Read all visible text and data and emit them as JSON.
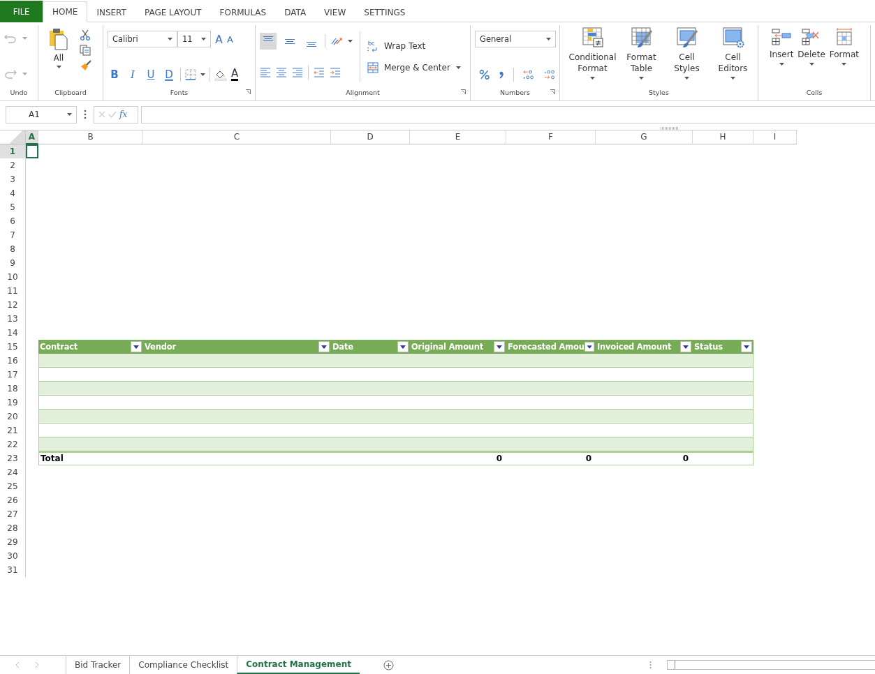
{
  "file_button": "FILE",
  "menu_tabs": [
    {
      "label": "HOME",
      "selected": true
    },
    {
      "label": "INSERT",
      "selected": false
    },
    {
      "label": "PAGE LAYOUT",
      "selected": false
    },
    {
      "label": "FORMULAS",
      "selected": false
    },
    {
      "label": "DATA",
      "selected": false
    },
    {
      "label": "VIEW",
      "selected": false
    },
    {
      "label": "SETTINGS",
      "selected": false
    }
  ],
  "ribbon": {
    "undo": {
      "group_label": "Undo"
    },
    "clipboard": {
      "paste_label": "All",
      "group_label": "Clipboard"
    },
    "fonts": {
      "font_name": "Calibri",
      "font_size": "11",
      "grow_label": "A",
      "shrink_label": "A",
      "font_color_label": "A",
      "group_label": "Fonts",
      "style_buttons": [
        {
          "label": "B",
          "kind": "bold"
        },
        {
          "label": "I",
          "kind": "italic"
        },
        {
          "label": "U",
          "kind": "underline"
        },
        {
          "label": "D",
          "kind": "double-underline"
        }
      ]
    },
    "alignment": {
      "vertical_buttons": [
        {
          "kind": "top",
          "selected": true
        },
        {
          "kind": "middle",
          "selected": false
        },
        {
          "kind": "bottom",
          "selected": false
        }
      ],
      "wrap_text": "Wrap Text",
      "merge": "Merge & Center",
      "group_label": "Alignment"
    },
    "numbers": {
      "format": "General",
      "group_label": "Numbers"
    },
    "styles": {
      "buttons": [
        {
          "label": "Conditional Format",
          "kind": "conditional-format"
        },
        {
          "label": "Format Table",
          "kind": "format-table"
        },
        {
          "label": "Cell Styles",
          "kind": "cell-styles"
        },
        {
          "label": "Cell Editors",
          "kind": "cell-editors"
        }
      ],
      "group_label": "Styles"
    },
    "cells": {
      "buttons": [
        {
          "label": "Insert",
          "kind": "insert"
        },
        {
          "label": "Delete",
          "kind": "delete"
        },
        {
          "label": "Format",
          "kind": "format"
        }
      ],
      "group_label": "Cells"
    }
  },
  "formula_bar": {
    "name_box": "A1",
    "fx": "fx"
  },
  "sheet": {
    "columns": [
      {
        "label": "A",
        "selected": true
      },
      {
        "label": "B",
        "selected": false
      },
      {
        "label": "C",
        "selected": false
      },
      {
        "label": "D",
        "selected": false
      },
      {
        "label": "E",
        "selected": false
      },
      {
        "label": "F",
        "selected": false
      },
      {
        "label": "G",
        "selected": false
      },
      {
        "label": "H",
        "selected": false
      },
      {
        "label": "I",
        "selected": false
      }
    ],
    "rows": [
      {
        "label": "1",
        "selected": true
      },
      {
        "label": "2",
        "selected": false
      },
      {
        "label": "3",
        "selected": false
      },
      {
        "label": "4",
        "selected": false
      },
      {
        "label": "5",
        "selected": false
      },
      {
        "label": "6",
        "selected": false
      },
      {
        "label": "7",
        "selected": false
      },
      {
        "label": "8",
        "selected": false
      },
      {
        "label": "9",
        "selected": false
      },
      {
        "label": "10",
        "selected": false
      },
      {
        "label": "11",
        "selected": false
      },
      {
        "label": "12",
        "selected": false
      },
      {
        "label": "13",
        "selected": false
      },
      {
        "label": "14",
        "selected": false
      },
      {
        "label": "15",
        "selected": false
      },
      {
        "label": "16",
        "selected": false
      },
      {
        "label": "17",
        "selected": false
      },
      {
        "label": "18",
        "selected": false
      },
      {
        "label": "19",
        "selected": false
      },
      {
        "label": "20",
        "selected": false
      },
      {
        "label": "21",
        "selected": false
      },
      {
        "label": "22",
        "selected": false
      },
      {
        "label": "23",
        "selected": false
      },
      {
        "label": "24",
        "selected": false
      },
      {
        "label": "25",
        "selected": false
      },
      {
        "label": "26",
        "selected": false
      },
      {
        "label": "27",
        "selected": false
      },
      {
        "label": "28",
        "selected": false
      },
      {
        "label": "29",
        "selected": false
      },
      {
        "label": "30",
        "selected": false
      },
      {
        "label": "31",
        "selected": false
      }
    ]
  },
  "table": {
    "columns": [
      {
        "label": "Contract"
      },
      {
        "label": "Vendor"
      },
      {
        "label": "Date"
      },
      {
        "label": "Original Amount",
        "total": "0"
      },
      {
        "label": "Forecasted Amou",
        "total": "0"
      },
      {
        "label": "Invoiced Amount",
        "total": "0"
      },
      {
        "label": "Status"
      }
    ],
    "body_rows": [
      {
        "banded": true
      },
      {
        "banded": false
      },
      {
        "banded": true
      },
      {
        "banded": false
      },
      {
        "banded": true
      },
      {
        "banded": false
      },
      {
        "banded": true
      }
    ],
    "total_label": "Total"
  },
  "sheet_tabs": [
    {
      "label": "Bid Tracker",
      "selected": false
    },
    {
      "label": "Compliance Checklist",
      "selected": false
    },
    {
      "label": "Contract Management",
      "selected": true
    }
  ]
}
